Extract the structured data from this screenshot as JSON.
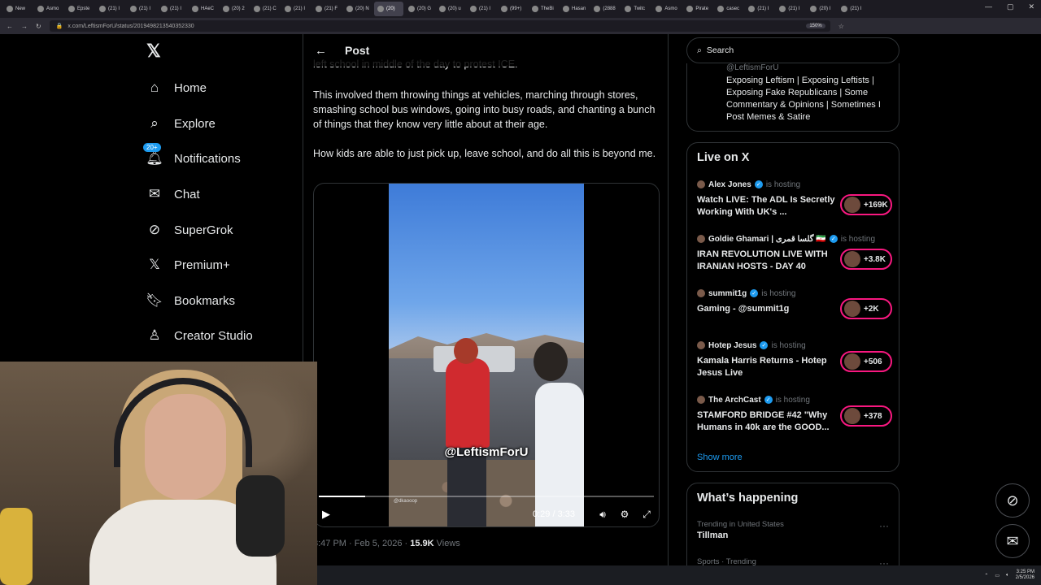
{
  "browser": {
    "tabs": [
      "New",
      "Asmo",
      "Epste",
      "(21) I",
      "(21) I",
      "(21) I",
      "HAeC",
      "(20) 2",
      "(21) C",
      "(21) I",
      "(21) F",
      "(20) N",
      "(20)",
      "(20) G",
      "(20) u",
      "(21) I",
      "(99+)",
      "TheBi",
      "Hasan",
      "(2888",
      "Twitc",
      "Asmo",
      "Pirate",
      "casec",
      "(21) I",
      "(21) I",
      "(20) I",
      "(21) I"
    ],
    "active_tab_index": 12,
    "url": "x.com/LeftismForU/status/2019498213540352330",
    "zoom": "150%"
  },
  "nav": {
    "items": [
      {
        "label": "Home",
        "icon": "home-icon"
      },
      {
        "label": "Explore",
        "icon": "search-icon"
      },
      {
        "label": "Notifications",
        "icon": "bell-icon",
        "badge": "20+"
      },
      {
        "label": "Chat",
        "icon": "mail-icon"
      },
      {
        "label": "SuperGrok",
        "icon": "grok-icon"
      },
      {
        "label": "Premium+",
        "icon": "x-icon"
      },
      {
        "label": "Bookmarks",
        "icon": "bookmark-icon"
      },
      {
        "label": "Creator Studio",
        "icon": "creator-icon"
      }
    ]
  },
  "post": {
    "header_title": "Post",
    "cut_text": "left school in middle of the day to protest ICE.",
    "paragraph1": "This involved them throwing things at vehicles, marching through stores, smashing school bus windows, going into busy roads, and chanting a bunch of things that they know very little about at their age.",
    "paragraph2": "How kids are able to just pick up, leave school, and do all this is beyond me.",
    "video": {
      "watermark": "@LeftismForU",
      "small_watermark": "@dkaooop",
      "time": "0:29 / 3:33",
      "progress_fraction": 0.138
    },
    "meta_time": "3:47 PM · Feb 5, 2026 · ",
    "views_count": "15.9K",
    "views_label": " Views"
  },
  "right": {
    "search_placeholder": "Search",
    "who_handle": "@LeftismForU",
    "who_bio": "Exposing Leftism | Exposing Leftists | Exposing Fake Republicans | Some Commentary & Opinions | Sometimes I Post Memes & Satire",
    "live_title": "Live on X",
    "hosting_label": "is hosting",
    "live": [
      {
        "host": "Alex Jones",
        "title": "Watch LIVE: The ADL Is Secretly Working With UK's ...",
        "count": "+169K"
      },
      {
        "host": "Goldie Ghamari | گلسا قمری 🇮🇷",
        "title": "IRAN REVOLUTION LIVE WITH IRANIAN HOSTS - DAY 40",
        "count": "+3.8K"
      },
      {
        "host": "summit1g",
        "title": "Gaming - @summit1g",
        "count": "+2K"
      },
      {
        "host": "Hotep Jesus",
        "title": "Kamala Harris Returns - Hotep Jesus Live",
        "count": "+506"
      },
      {
        "host": "The ArchCast",
        "title": "STAMFORD BRIDGE #42 \"Why Humans in 40k are the GOOD...",
        "count": "+378"
      }
    ],
    "show_more": "Show more",
    "happening_title": "What’s happening",
    "trends": [
      {
        "context": "Trending in United States",
        "name": "Tillman"
      },
      {
        "context": "Sports · Trending",
        "name": ""
      }
    ]
  },
  "taskbar": {
    "time": "3:25 PM",
    "date": "2/5/2026"
  },
  "colors": {
    "accent": "#1d9bf0",
    "live_ring": "#f91880",
    "border": "#2f3336",
    "muted": "#71767b"
  }
}
